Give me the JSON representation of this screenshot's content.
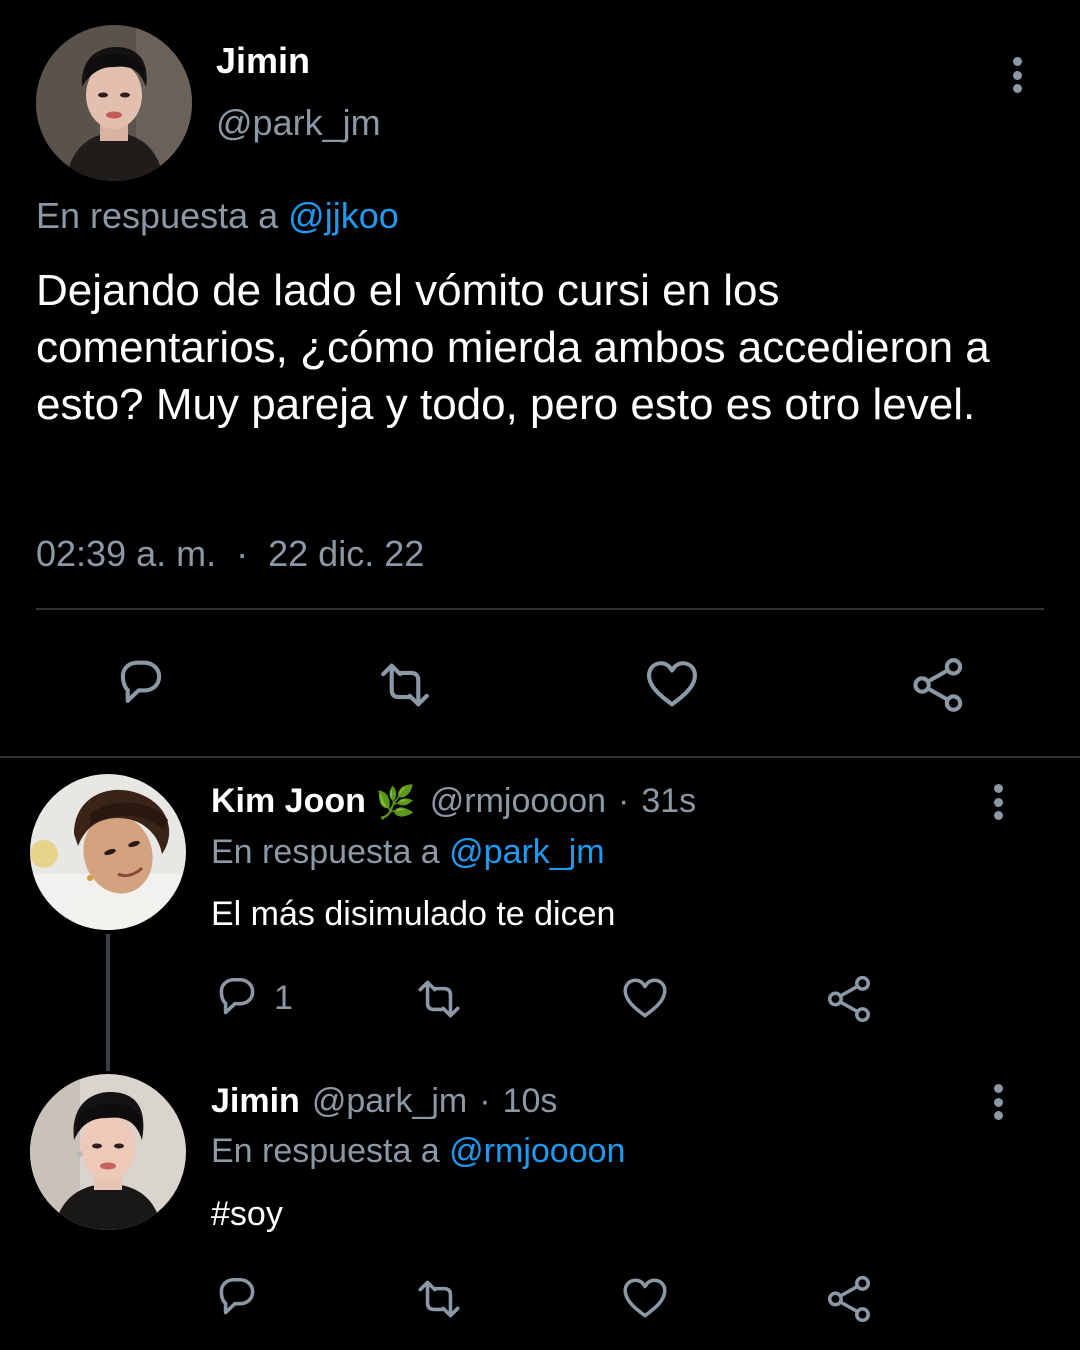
{
  "main_tweet": {
    "author_name": "Jimin",
    "author_handle": "@park_jm",
    "replying_prefix": "En respuesta a",
    "replying_to": "@jjkoo",
    "text": "Dejando de lado el vómito cursi en los comentarios, ¿cómo mierda ambos accedieron a esto? Muy pareja y todo, pero esto es otro level.",
    "time": "02:39 a. m.",
    "separator": "·",
    "date": "22 dic. 22",
    "actions": [
      "reply-icon",
      "retweet-icon",
      "like-icon",
      "share-icon"
    ]
  },
  "replies": [
    {
      "author_name": "Kim Joon",
      "badge_emoji": "🌿",
      "author_handle": "@rmjoooon",
      "separator": "·",
      "time": "31s",
      "replying_prefix": "En respuesta a",
      "replying_to": "@park_jm",
      "text": "El más disimulado te dicen",
      "reply_count": "1"
    },
    {
      "author_name": "Jimin",
      "author_handle": "@park_jm",
      "separator": "·",
      "time": "10s",
      "replying_prefix": "En respuesta a",
      "replying_to": "@rmjoooon",
      "text": "#soy",
      "reply_count": ""
    }
  ],
  "colors": {
    "background": "#000000",
    "text": "#e7e9ea",
    "muted": "#8b98a5",
    "link": "#1d9bf0",
    "divider": "#2f3336"
  }
}
